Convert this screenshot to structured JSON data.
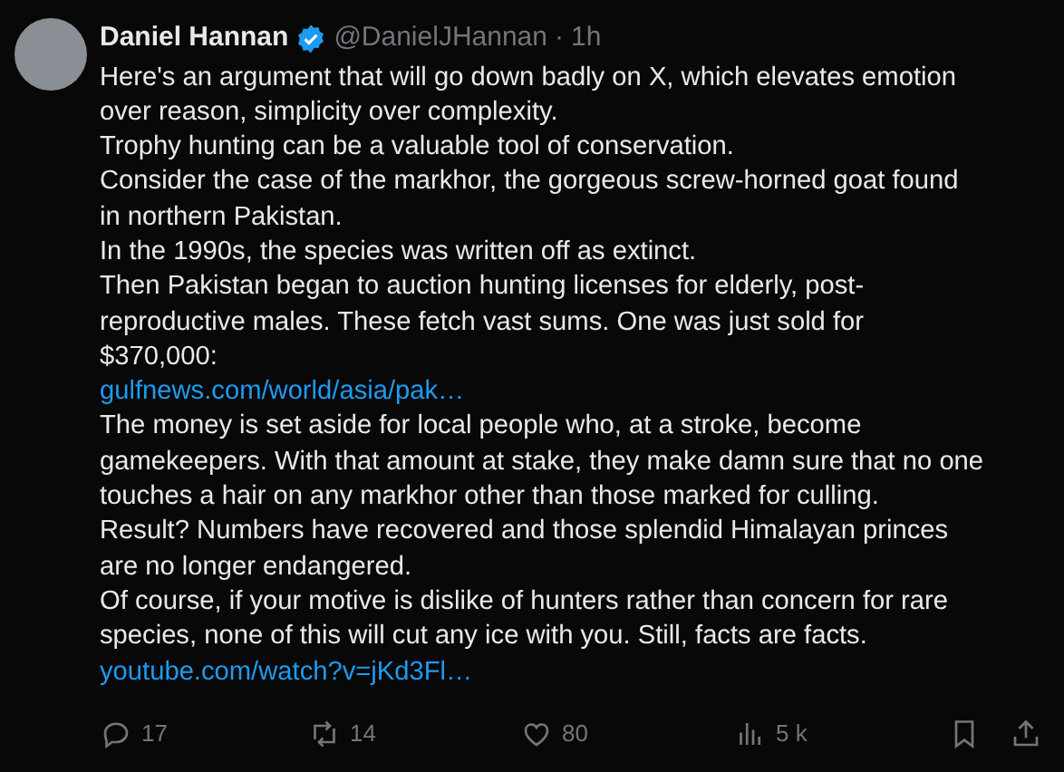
{
  "post": {
    "author": {
      "name": "Daniel Hannan",
      "verified": true,
      "handle": "@DanielJHannan",
      "separator": "·",
      "time": "1h"
    },
    "body": [
      {
        "kind": "text",
        "text": "Here's an argument that will go down badly on X, which elevates emotion over reason, simplicity over complexity."
      },
      {
        "kind": "text",
        "text": "Trophy hunting can be a valuable tool of conservation."
      },
      {
        "kind": "text",
        "text": "Consider the case of the markhor, the gorgeous screw-horned goat found in northern Pakistan."
      },
      {
        "kind": "text",
        "text": "In the 1990s, the species was written off as extinct."
      },
      {
        "kind": "text",
        "text": "Then Pakistan began to auction hunting licenses for elderly, post-reproductive males. These fetch vast sums. One was just sold for $370,000:"
      },
      {
        "kind": "link",
        "text": "gulfnews.com/world/asia/pak…"
      },
      {
        "kind": "text",
        "text": "The money is set aside for local people who, at a stroke, become gamekeepers. With that amount at stake, they make damn sure that no one touches a hair on any markhor other than those marked for culling."
      },
      {
        "kind": "text",
        "text": "Result? Numbers have recovered and those splendid Himalayan princes are no longer endangered."
      },
      {
        "kind": "text",
        "text": "Of course, if your motive is dislike of hunters rather than concern for rare species, none of this will cut any ice with you. Still, facts are facts."
      },
      {
        "kind": "link",
        "text": "youtube.com/watch?v=jKd3Fl…"
      }
    ],
    "actions": [
      {
        "kind": "reply",
        "count": "17"
      },
      {
        "kind": "repost",
        "count": "14"
      },
      {
        "kind": "like",
        "count": "80"
      },
      {
        "kind": "views",
        "count": "5 k"
      },
      {
        "kind": "bookmark"
      },
      {
        "kind": "share"
      }
    ]
  }
}
